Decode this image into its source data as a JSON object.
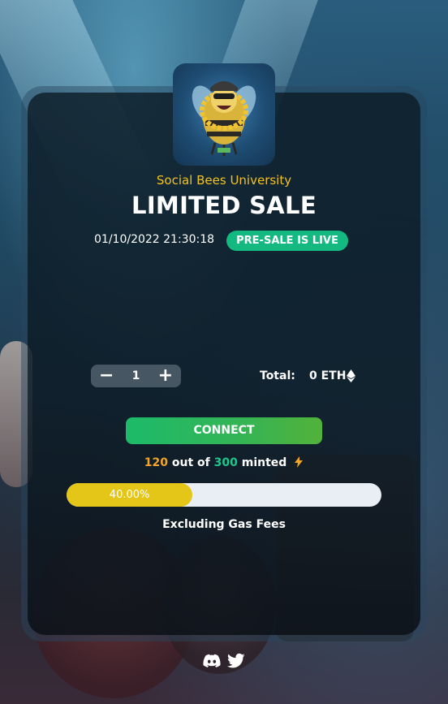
{
  "header": {
    "collection_name": "Social Bees University",
    "title": "LIMITED SALE",
    "datetime": "01/10/2022 21:30:18",
    "status_badge": "PRE-SALE IS LIVE"
  },
  "mint": {
    "decrement_label": "−",
    "quantity": "1",
    "increment_label": "+",
    "total_label": "Total:",
    "total_value": "0 ETH",
    "currency_icon": "ethereum-icon"
  },
  "connect_button": "CONNECT",
  "progress": {
    "minted": "120",
    "out_of_text": "out of",
    "supply": "300",
    "minted_text": "minted",
    "percent_label": "40.00%",
    "fraction": 0.4
  },
  "footnote": "Excluding Gas Fees",
  "socials": [
    "discord-icon",
    "twitter-icon"
  ],
  "colors": {
    "accent_yellow": "#f4c21e",
    "badge_green": "#14b981",
    "progress_fill": "#e4c618",
    "minted_orange": "#f5a524",
    "supply_green": "#1cc88a"
  }
}
